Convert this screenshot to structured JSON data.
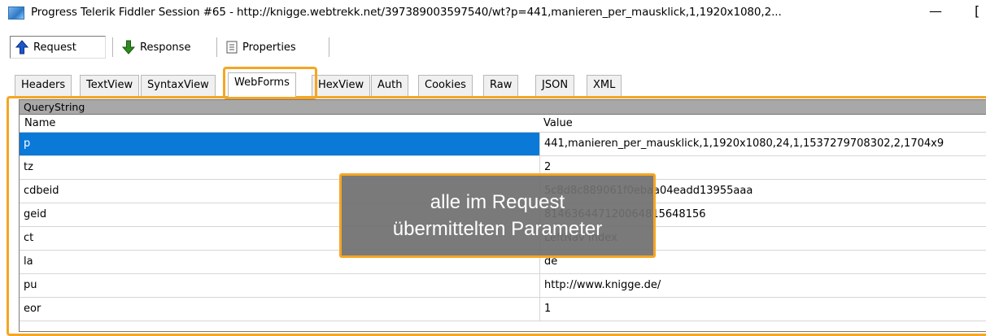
{
  "window": {
    "title": "Progress Telerik Fiddler Session #65 - http://knigge.webtrekk.net/397389003597540/wt?p=441,manieren_per_mausklick,1,1920x1080,2...",
    "minimize_glyph": "—",
    "maximize_glyph": "["
  },
  "toolbar": {
    "request_label": "Request",
    "response_label": "Response",
    "properties_label": "Properties"
  },
  "tabs": [
    "Headers",
    "TextView",
    "SyntaxView",
    "WebForms",
    "HexView",
    "Auth",
    "Cookies",
    "Raw",
    "JSON",
    "XML"
  ],
  "active_tab": "WebForms",
  "grid": {
    "group_title": "QueryString",
    "columns": [
      "Name",
      "Value"
    ],
    "rows": [
      {
        "name": "p",
        "value": "441,manieren_per_mausklick,1,1920x1080,24,1,1537279708302,2,1704x9"
      },
      {
        "name": "tz",
        "value": "2"
      },
      {
        "name": "cdbeid",
        "value": "5c8d8c889061f0ebaa04eadd13955aaa"
      },
      {
        "name": "geid",
        "value": "814636447120064815648156"
      },
      {
        "name": "ct",
        "value": "LeftNav Index"
      },
      {
        "name": "la",
        "value": "de"
      },
      {
        "name": "pu",
        "value": "http://www.knigge.de/"
      },
      {
        "name": "eor",
        "value": "1"
      }
    ],
    "selected_row": "p"
  },
  "callout": {
    "line1": "alle im Request",
    "line2": "übermittelten Parameter"
  },
  "colors": {
    "highlight": "#f5a623",
    "selection": "#0a79d8"
  },
  "icons": {
    "request": "arrow-up-icon",
    "response": "arrow-down-icon",
    "properties": "document-icon",
    "app": "fiddler-app-icon"
  }
}
